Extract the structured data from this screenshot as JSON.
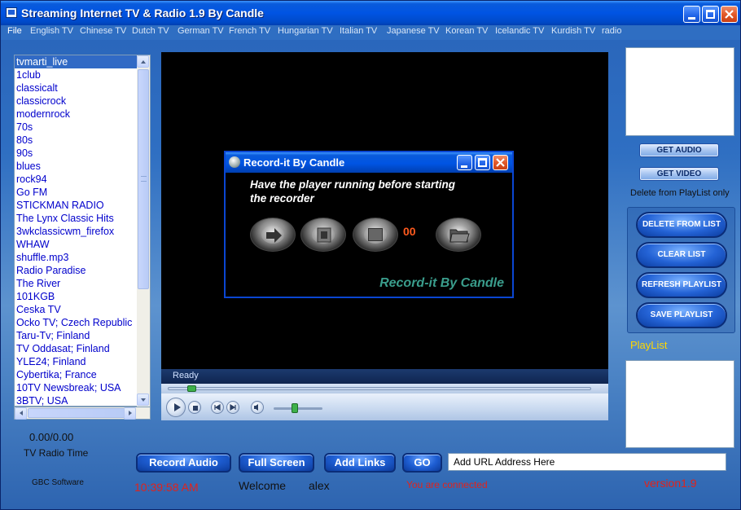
{
  "window": {
    "title": "Streaming Internet TV & Radio 1.9 By Candle"
  },
  "menu": [
    "File",
    "English TV",
    "Chinese TV",
    "Dutch TV",
    "German TV",
    "French TV",
    "Hungarian TV",
    "Italian TV",
    "Japanese TV",
    "Korean TV",
    "Icelandic TV",
    "Kurdish TV",
    "radio"
  ],
  "channels": [
    "tvmarti_live",
    "1club",
    "classicalt",
    "classicrock",
    "modernrock",
    "70s",
    "80s",
    "90s",
    "blues",
    "rock94",
    "Go FM",
    "STICKMAN RADIO",
    "The Lynx Classic Hits",
    "3wkclassicwm_firefox",
    "WHAW",
    "shuffle.mp3",
    "Radio Paradise",
    "The River",
    "101KGB",
    "Ceska TV",
    "Ocko TV; Czech Republic",
    "Taru-Tv; Finland",
    "TV Oddasat; Finland",
    "YLE24; Finland",
    "Cybertika; France",
    "10TV Newsbreak; USA",
    "3BTV; USA"
  ],
  "selected_channel": "tvmarti_live",
  "left_panel": {
    "time_counter": "0.00/0.00",
    "time_label": "TV Radio Time",
    "company": "GBC Software"
  },
  "player": {
    "status": "Ready"
  },
  "record_dialog": {
    "title": "Record-it By Candle",
    "message": "Have the player running before starting the recorder",
    "counter": "00",
    "brand": "Record-it By Candle"
  },
  "right_panel": {
    "get_audio": "GET AUDIO",
    "get_video": "GET VIDEO",
    "delete_label": "Delete from PlayList only",
    "delete_from_list": "DELETE FROM LIST",
    "clear_list": "CLEAR LIST",
    "refresh_playlist": "REFRESH PLAYLIST",
    "save_playlist": "SAVE PLAYLIST",
    "playlist_label": "PlayList"
  },
  "bottom": {
    "record_audio": "Record Audio",
    "full_screen": "Full Screen",
    "add_links": "Add Links",
    "go": "GO",
    "url_placeholder": "Add URL Address Here",
    "clock": "10:39:58 AM",
    "welcome": "Welcome",
    "username": "alex",
    "status": "You are connected",
    "version": "version1.9"
  },
  "colors": {
    "accent_red": "#e0231c",
    "playlist_yellow": "#ffd700",
    "brand_teal": "#3a9d8c",
    "counter_orange": "#ff5a1e"
  }
}
